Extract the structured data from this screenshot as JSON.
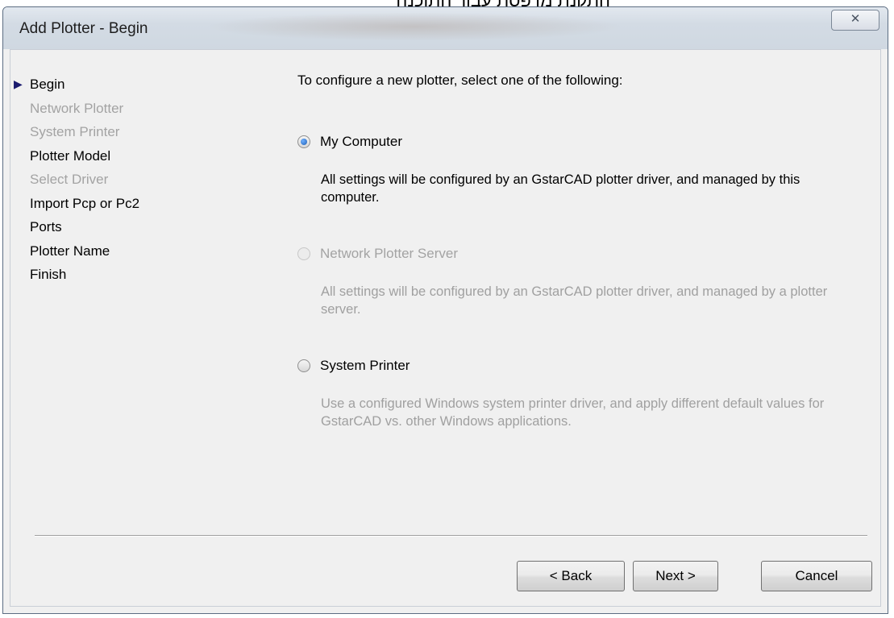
{
  "background_text": "התקנת מדפסת עבור התוכנה",
  "window": {
    "title": "Add Plotter - Begin",
    "close_label": "✕"
  },
  "steps": [
    {
      "label": "Begin",
      "current": true,
      "enabled": true
    },
    {
      "label": "Network Plotter",
      "current": false,
      "enabled": false
    },
    {
      "label": "System Printer",
      "current": false,
      "enabled": false
    },
    {
      "label": "Plotter Model",
      "current": false,
      "enabled": true
    },
    {
      "label": "Select Driver",
      "current": false,
      "enabled": false
    },
    {
      "label": "Import Pcp or Pc2",
      "current": false,
      "enabled": true
    },
    {
      "label": "Ports",
      "current": false,
      "enabled": true
    },
    {
      "label": "Plotter Name",
      "current": false,
      "enabled": true
    },
    {
      "label": "Finish",
      "current": false,
      "enabled": true
    }
  ],
  "instruction": "To configure a new plotter, select one of the following:",
  "options": [
    {
      "label": "My Computer",
      "selected": true,
      "enabled": true,
      "description": "All settings will be configured by an GstarCAD plotter driver, and managed by this computer."
    },
    {
      "label": "Network Plotter Server",
      "selected": false,
      "enabled": false,
      "description": "All settings will be configured by an GstarCAD plotter driver, and managed by a plotter server."
    },
    {
      "label": "System Printer",
      "selected": false,
      "enabled": true,
      "description": "Use a configured Windows system printer driver, and apply different default values for GstarCAD vs. other Windows applications."
    }
  ],
  "buttons": {
    "back": "< Back",
    "next": "Next >",
    "cancel": "Cancel"
  },
  "colors": {
    "disabled_text": "#a3a3a3",
    "radio_selected": "#1f5fb5"
  }
}
